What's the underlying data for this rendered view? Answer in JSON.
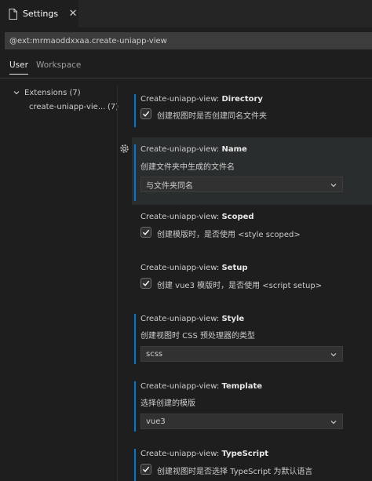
{
  "tab": {
    "label": "Settings",
    "close": "✕"
  },
  "search": {
    "value": "@ext:mrmaoddxxaa.create-uniapp-view"
  },
  "scope_tabs": {
    "user": "User",
    "workspace": "Workspace"
  },
  "toc": {
    "extensions": "Extensions (7)",
    "item_label": "create-uniapp-vie...",
    "item_count": "(7)"
  },
  "settings": [
    {
      "prefix": "Create-uniapp-view: ",
      "name": "Directory",
      "desc": "创建视图时是否创建同名文件夹",
      "checked": true
    },
    {
      "prefix": "Create-uniapp-view: ",
      "name": "Name",
      "desc": "创建文件夹中生成的文件名",
      "value": "与文件夹同名"
    },
    {
      "prefix": "Create-uniapp-view: ",
      "name": "Scoped",
      "desc": "创建模版时，是否使用 <style scoped>",
      "checked": true
    },
    {
      "prefix": "Create-uniapp-view: ",
      "name": "Setup",
      "desc": "创建 vue3 模版时，是否使用 <script setup>",
      "checked": true
    },
    {
      "prefix": "Create-uniapp-view: ",
      "name": "Style",
      "desc": "创建视图时 CSS 预处理器的类型",
      "value": "scss"
    },
    {
      "prefix": "Create-uniapp-view: ",
      "name": "Template",
      "desc": "选择创建的模版",
      "value": "vue3"
    },
    {
      "prefix": "Create-uniapp-view: ",
      "name": "TypeScript",
      "desc": "创建视图时是否选择 TypeScript 为默认语言",
      "checked": true
    }
  ],
  "colors": {
    "accent": "#0078d4",
    "background": "#1e1e1e",
    "input": "#313131"
  },
  "icons": {
    "tab": "file-icon",
    "gear": "gear-icon",
    "check": "check-icon",
    "chevron": "chevron-down-icon"
  }
}
